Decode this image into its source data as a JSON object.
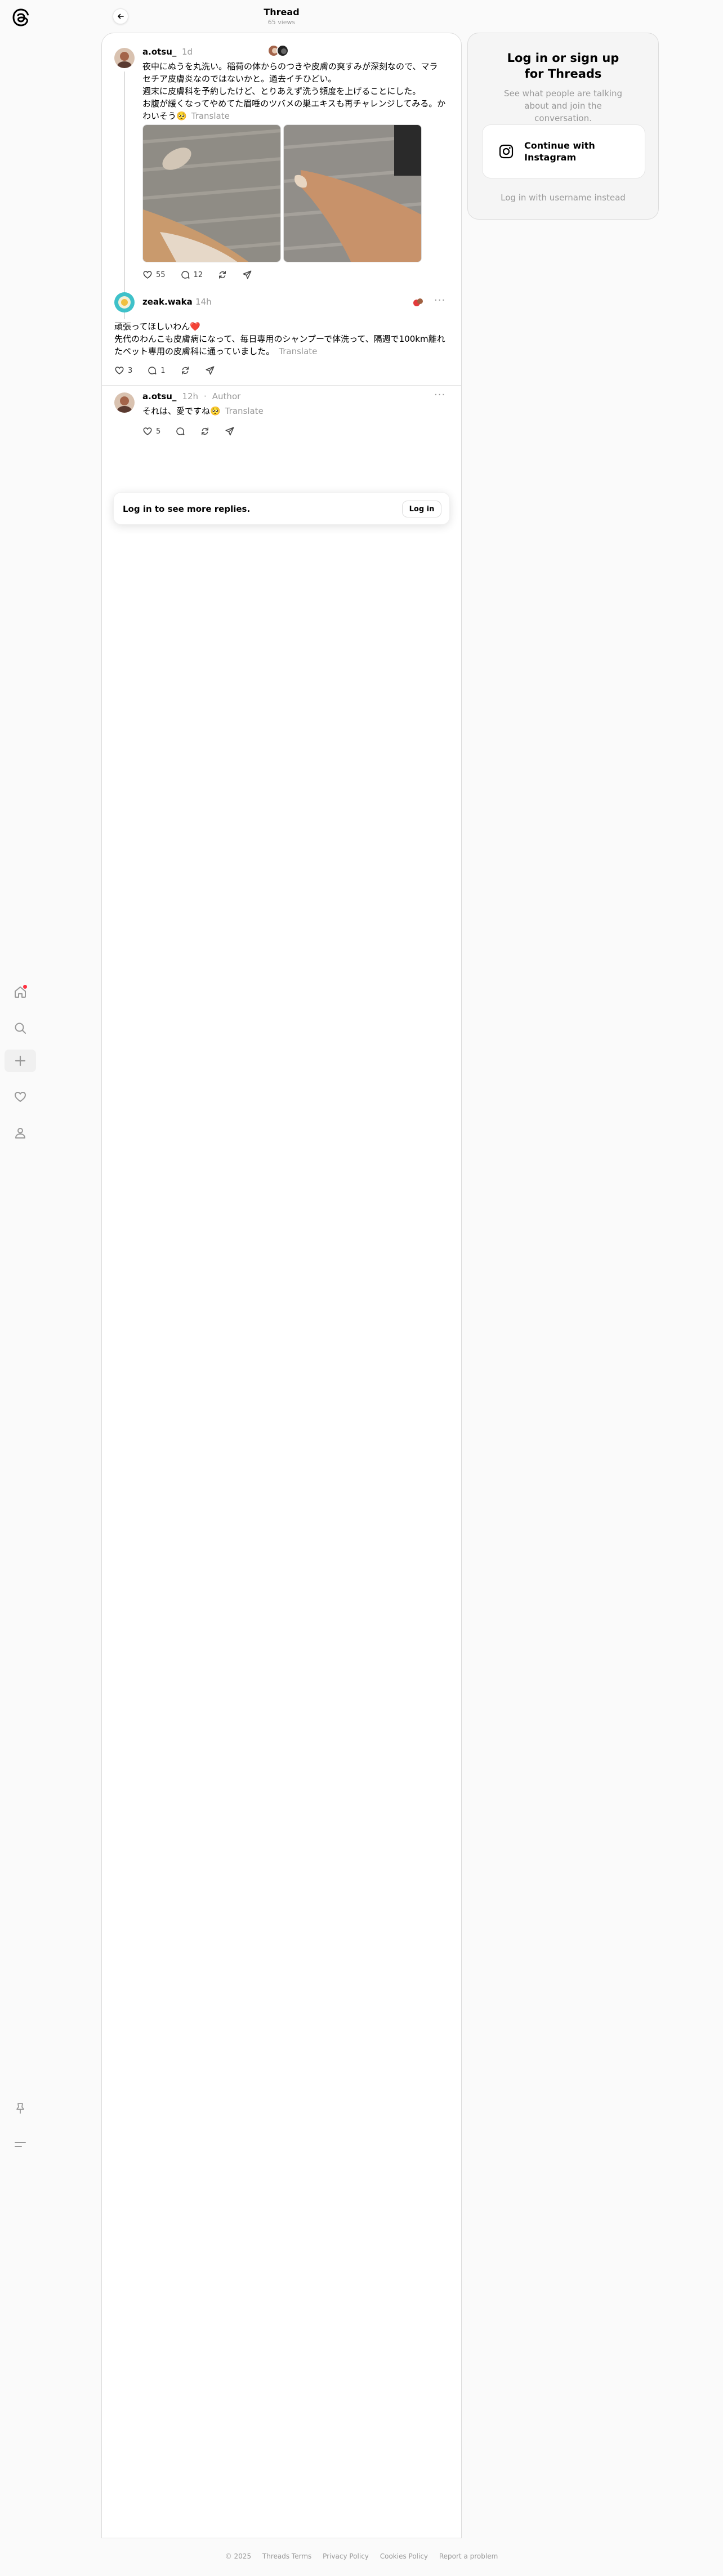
{
  "header": {
    "title": "Thread",
    "views": "65 views"
  },
  "post": {
    "username": "a.otsu_",
    "time": "1d",
    "lines": [
      "夜中にぬうを丸洗い。稲荷の体からのつきや皮膚の爽すみが深刻なので、マラ",
      "セチア皮膚炎なのではないかと。過去イチひどい。",
      "週末に皮膚科を予約したけど、とりあえず洗う頻度を上げることにした。",
      "お腹が緩くなってやめてた眉唾のツバメの巣エキスも再チャレンジしてみる。か",
      "わいそう🥺"
    ],
    "translate": "Translate",
    "likes": "55",
    "replies": "12"
  },
  "reply1": {
    "username": "zeak.waka",
    "time": "14h",
    "lines": [
      "頑張ってほしいわん❤️",
      "先代のわんこも皮膚病になって、毎日専用のシャンプーで体洗って、隔週で100km離れ",
      "たペット専用の皮膚科に通っていました。"
    ],
    "translate": "Translate",
    "likes": "3",
    "replies": "1"
  },
  "reply2": {
    "username": "a.otsu_",
    "time": "12h",
    "author": "Author",
    "text": "それは、愛ですね🥺",
    "translate": "Translate",
    "likes": "5"
  },
  "login_card": {
    "text": "Log in to see more replies.",
    "button": "Log in"
  },
  "side_panel": {
    "title": "Log in or sign up for Threads",
    "subtitle": "See what people are talking about and join the conversation.",
    "instagram": "Continue with Instagram",
    "username_login": "Log in with username instead"
  },
  "footer": [
    "© 2025",
    "Threads Terms",
    "Privacy Policy",
    "Cookies Policy",
    "Report a problem"
  ],
  "colors": {
    "accent": "#ff3040",
    "text": "#000000",
    "muted": "#999999",
    "background": "#fafafa"
  }
}
